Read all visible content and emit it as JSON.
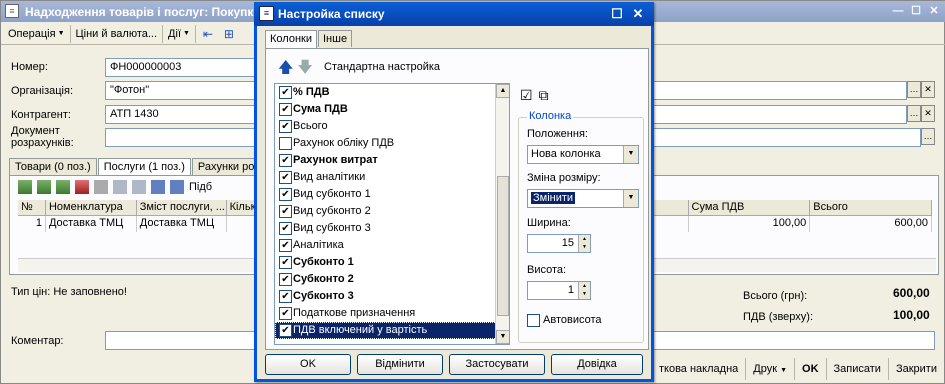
{
  "background": {
    "title": "Надходження товарів і послуг: Покупк",
    "toolbar": {
      "operation": "Операція",
      "prices": "Ціни й валюта...",
      "actions": "Дії"
    },
    "fields": {
      "number_label": "Номер:",
      "number_value": "ФН000000003",
      "org_label": "Організація:",
      "org_value": "\"Фотон\"",
      "contractor_label": "Контрагент:",
      "contractor_value": "АТП 1430",
      "doc_label_1": "Документ",
      "doc_label_2": "розрахунків:"
    },
    "tabs": [
      "Товари (0 поз.)",
      "Послуги (1 поз.)",
      "Рахунки ро"
    ],
    "grid": {
      "headers": [
        "№",
        "Номенклатура",
        "Зміст послуги, ...",
        "Кільк",
        "Сума ПДВ",
        "Всього"
      ],
      "row": [
        "1",
        "Доставка ТМЦ",
        "Доставка ТМЦ",
        "",
        "100,00",
        "600,00"
      ],
      "filter_label": "Підб"
    },
    "price_type": "Тип цін: Не заповнено!",
    "total_label": "Всього (грн):",
    "total_value": "600,00",
    "vat_label": "ПДВ (зверху):",
    "vat_value": "100,00",
    "comment_label": "Коментар:",
    "bottom_buttons": [
      "ткова накладна",
      "Друк",
      "OK",
      "Записати",
      "Закрити"
    ]
  },
  "dialog": {
    "title": "Настройка списку",
    "tabs": [
      "Колонки",
      "Інше"
    ],
    "std_setup": "Стандартна настройка",
    "columns": [
      {
        "label": "% ПДВ",
        "checked": true,
        "bold": true
      },
      {
        "label": "Сума ПДВ",
        "checked": true,
        "bold": true
      },
      {
        "label": "Всього",
        "checked": true,
        "bold": false
      },
      {
        "label": "Рахунок обліку ПДВ",
        "checked": false,
        "bold": false
      },
      {
        "label": "Рахунок витрат",
        "checked": true,
        "bold": true
      },
      {
        "label": "Вид аналітики",
        "checked": true,
        "bold": false
      },
      {
        "label": "Вид субконто 1",
        "checked": true,
        "bold": false
      },
      {
        "label": "Вид субконто 2",
        "checked": true,
        "bold": false
      },
      {
        "label": "Вид субконто 3",
        "checked": true,
        "bold": false
      },
      {
        "label": "Аналітика",
        "checked": true,
        "bold": false
      },
      {
        "label": "Субконто 1",
        "checked": true,
        "bold": true
      },
      {
        "label": "Субконто 2",
        "checked": true,
        "bold": true
      },
      {
        "label": "Субконто 3",
        "checked": true,
        "bold": true
      },
      {
        "label": "Податкове призначення",
        "checked": true,
        "bold": false
      },
      {
        "label": "ПДВ включений у вартість",
        "checked": true,
        "bold": false,
        "selected": true
      }
    ],
    "group_title": "Колонка",
    "position_label": "Положення:",
    "position_value": "Нова колонка",
    "resize_label": "Зміна розміру:",
    "resize_value": "Змінити",
    "width_label": "Ширина:",
    "width_value": "15",
    "height_label": "Висота:",
    "height_value": "1",
    "auto_height": "Автовисота",
    "buttons": {
      "ok": "OK",
      "cancel": "Відмінити",
      "apply": "Застосувати",
      "help": "Довідка"
    }
  }
}
